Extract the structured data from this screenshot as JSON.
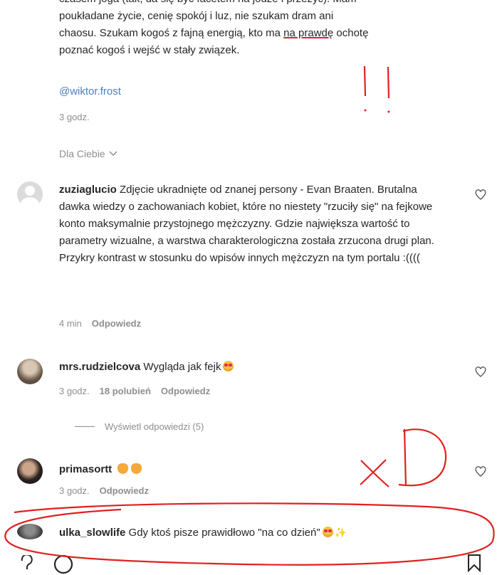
{
  "post": {
    "text_lines": [
      "czasem joga (tak, da się być facetem na jodze i przeżyć). Mam",
      "poukładane życie, cenię spokój i luz, nie szukam dram ani",
      "chaosu. Szukam kogoś z fajną energią, kto ma ",
      "na prawdę",
      " ochotę",
      "poznać kogoś i wejść w stały związek."
    ],
    "mention": "@wiktor.frost",
    "time": "3 godz."
  },
  "filter": {
    "label": "Dla Ciebie"
  },
  "comments": [
    {
      "username": "zuziaglucio",
      "text": "Zdjęcie ukradnięte od znanej persony - Evan Braaten. Brutalna dawka wiedzy o zachowaniach kobiet, które no niestety \"rzuciły się\" na fejkowe konto maksymalnie przystojnego mężczyzny. Gdzie największa wartość to parametry wizualne, a warstwa charakterologiczna została zrzucona drugi plan. Przykry kontrast w stosunku do wpisów innych mężczyzn na tym portalu :((((",
      "time": "4 min",
      "reply": "Odpowiedz"
    },
    {
      "username": "mrs.rudzielcova",
      "text": "Wygląda jak fejk",
      "time": "3 godz.",
      "likes": "18 polubień",
      "reply": "Odpowiedz"
    },
    {
      "username": "primasortt",
      "text": "",
      "time": "3 godz.",
      "reply": "Odpowiedz"
    },
    {
      "username": "ulka_slowlife",
      "text": "Gdy ktoś pisze prawidłowo \"na co dzień\""
    }
  ],
  "view_replies": {
    "label": "Wyświetl odpowiedzi (5)"
  },
  "annotations": {
    "handwriting": "xD",
    "exclamations": "!!",
    "color": "#e02020"
  },
  "colors": {
    "text": "#262626",
    "muted": "#8e8e8e",
    "link": "#4a7fc1",
    "annotation": "#e02020"
  }
}
